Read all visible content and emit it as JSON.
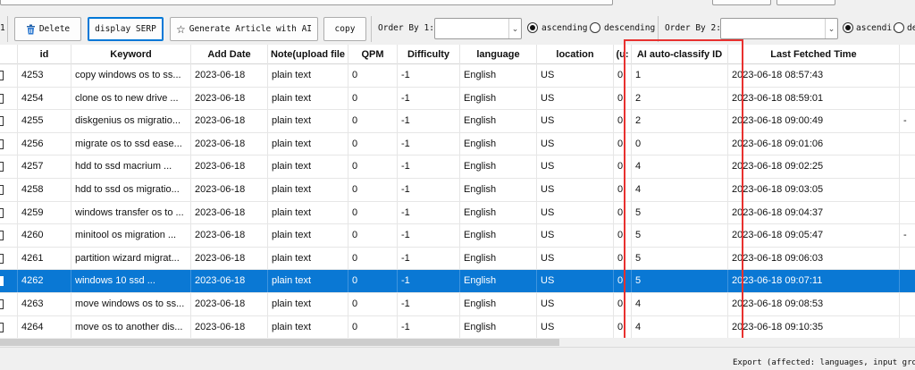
{
  "toolbar": {
    "left_fragment": "1",
    "delete_label": "Delete",
    "display_serp_label": "display SERP",
    "generate_label": "Generate Article with AI",
    "copy_label": "copy",
    "order_by_1_label": "Order By 1:",
    "order_by_1_value": "",
    "ascending_label": "ascending",
    "descending_label": "descending",
    "order_by_2_label": "Order By 2:",
    "order_by_2_value": "",
    "ascending_2_label": "ascendi:",
    "descending_2_fragment": "de",
    "order1_direction": "ascending",
    "order2_direction": "ascending"
  },
  "table": {
    "columns": [
      "",
      "id",
      "Keyword",
      "Add Date",
      "Note(upload file",
      "QPM",
      "Difficulty",
      "language",
      "location",
      "(u:",
      "AI auto-classify ID",
      "Last Fetched Time",
      ""
    ],
    "selected_index": 9,
    "rows": [
      {
        "id": "4253",
        "keyword": "copy windows os to ss...",
        "add_date": "2023-06-18",
        "note": "plain text",
        "qpm": "0",
        "difficulty": "-1",
        "language": "English",
        "location": "US",
        "u": "0",
        "ai_id": "1",
        "last_fetched": "2023-06-18 08:57:43",
        "extra": ""
      },
      {
        "id": "4254",
        "keyword": "clone os to new drive ...",
        "add_date": "2023-06-18",
        "note": "plain text",
        "qpm": "0",
        "difficulty": "-1",
        "language": "English",
        "location": "US",
        "u": "0",
        "ai_id": "2",
        "last_fetched": "2023-06-18 08:59:01",
        "extra": ""
      },
      {
        "id": "4255",
        "keyword": "diskgenius os migratio...",
        "add_date": "2023-06-18",
        "note": "plain text",
        "qpm": "0",
        "difficulty": "-1",
        "language": "English",
        "location": "US",
        "u": "0",
        "ai_id": "2",
        "last_fetched": "2023-06-18 09:00:49",
        "extra": "-"
      },
      {
        "id": "4256",
        "keyword": "migrate os to ssd ease...",
        "add_date": "2023-06-18",
        "note": "plain text",
        "qpm": "0",
        "difficulty": "-1",
        "language": "English",
        "location": "US",
        "u": "0",
        "ai_id": "0",
        "last_fetched": "2023-06-18 09:01:06",
        "extra": ""
      },
      {
        "id": "4257",
        "keyword": "hdd to ssd macrium ...",
        "add_date": "2023-06-18",
        "note": "plain text",
        "qpm": "0",
        "difficulty": "-1",
        "language": "English",
        "location": "US",
        "u": "0",
        "ai_id": "4",
        "last_fetched": "2023-06-18 09:02:25",
        "extra": ""
      },
      {
        "id": "4258",
        "keyword": "hdd to ssd os migratio...",
        "add_date": "2023-06-18",
        "note": "plain text",
        "qpm": "0",
        "difficulty": "-1",
        "language": "English",
        "location": "US",
        "u": "0",
        "ai_id": "4",
        "last_fetched": "2023-06-18 09:03:05",
        "extra": ""
      },
      {
        "id": "4259",
        "keyword": "windows transfer os to ...",
        "add_date": "2023-06-18",
        "note": "plain text",
        "qpm": "0",
        "difficulty": "-1",
        "language": "English",
        "location": "US",
        "u": "0",
        "ai_id": "5",
        "last_fetched": "2023-06-18 09:04:37",
        "extra": ""
      },
      {
        "id": "4260",
        "keyword": "minitool os migration ...",
        "add_date": "2023-06-18",
        "note": "plain text",
        "qpm": "0",
        "difficulty": "-1",
        "language": "English",
        "location": "US",
        "u": "0",
        "ai_id": "5",
        "last_fetched": "2023-06-18 09:05:47",
        "extra": "-"
      },
      {
        "id": "4261",
        "keyword": "partition wizard migrat...",
        "add_date": "2023-06-18",
        "note": "plain text",
        "qpm": "0",
        "difficulty": "-1",
        "language": "English",
        "location": "US",
        "u": "0",
        "ai_id": "5",
        "last_fetched": "2023-06-18 09:06:03",
        "extra": ""
      },
      {
        "id": "4262",
        "keyword": "windows 10 ssd ...",
        "add_date": "2023-06-18",
        "note": "plain text",
        "qpm": "0",
        "difficulty": "-1",
        "language": "English",
        "location": "US",
        "u": "0",
        "ai_id": "5",
        "last_fetched": "2023-06-18 09:07:11",
        "extra": ""
      },
      {
        "id": "4263",
        "keyword": "move windows os to ss...",
        "add_date": "2023-06-18",
        "note": "plain text",
        "qpm": "0",
        "difficulty": "-1",
        "language": "English",
        "location": "US",
        "u": "0",
        "ai_id": "4",
        "last_fetched": "2023-06-18 09:08:53",
        "extra": ""
      },
      {
        "id": "4264",
        "keyword": "move os to another dis...",
        "add_date": "2023-06-18",
        "note": "plain text",
        "qpm": "0",
        "difficulty": "-1",
        "language": "English",
        "location": "US",
        "u": "0",
        "ai_id": "4",
        "last_fetched": "2023-06-18 09:10:35",
        "extra": ""
      }
    ]
  },
  "status_bar": {
    "text": "Export (affected: languages, input group"
  },
  "colors": {
    "selection": "#0a78d4",
    "highlight_box": "#e8312f",
    "primary_border": "#0078d7"
  }
}
